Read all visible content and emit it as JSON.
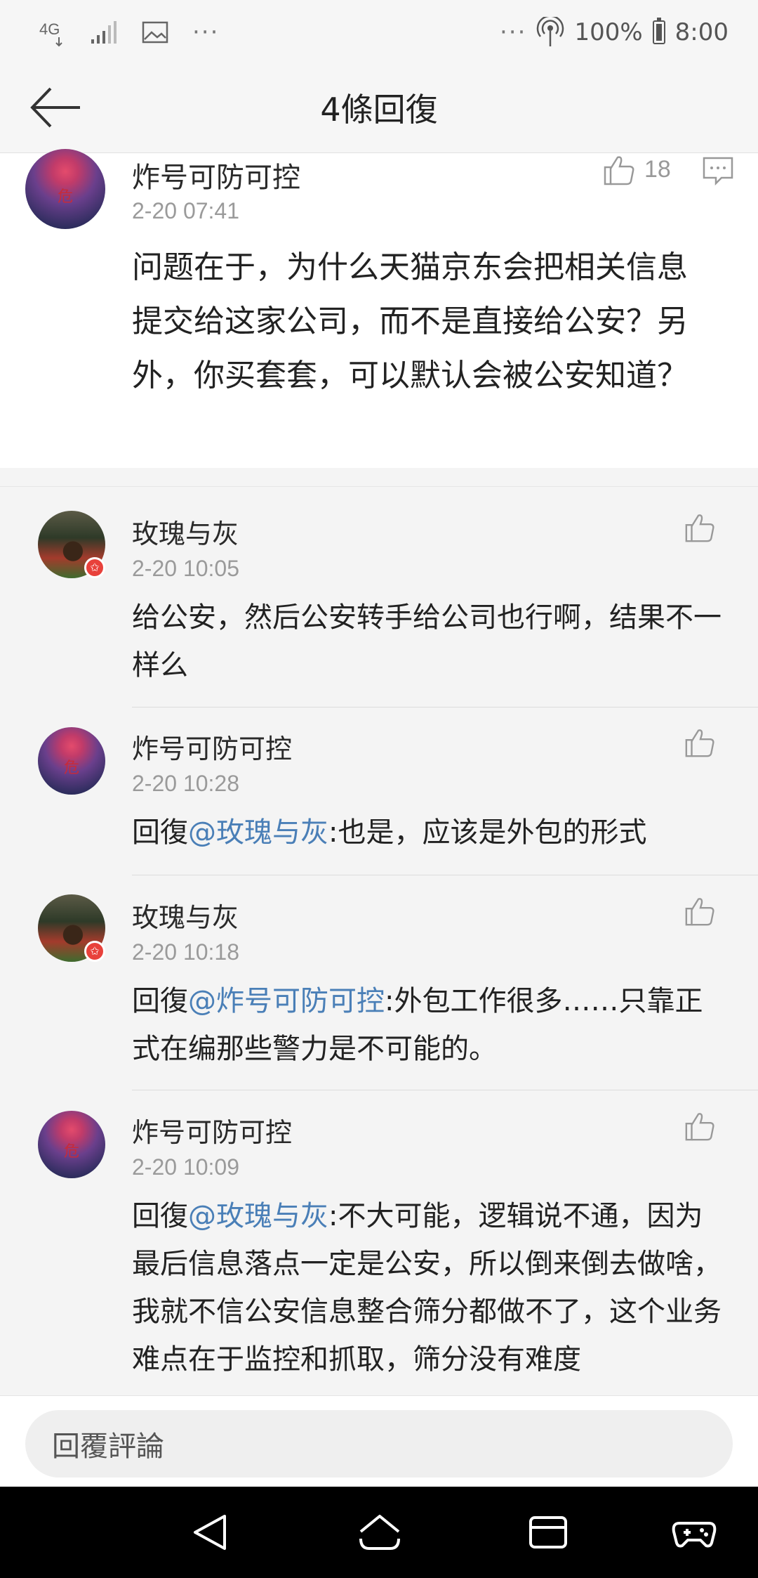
{
  "status_bar": {
    "network": "4G",
    "overflow": "···",
    "right_overflow": "···",
    "battery": "100%",
    "time": "8:00"
  },
  "header": {
    "back_icon": "back-arrow-icon",
    "title": "4條回復"
  },
  "main_comment": {
    "author": "炸号可防可控",
    "avatar_text": "危",
    "time": "2-20 07:41",
    "likes": "18",
    "text": "问题在于，为什么天猫京东会把相关信息提交给这家公司，而不是直接给公安？另外，你买套套，可以默认会被公安知道？"
  },
  "replies": [
    {
      "author": "玫瑰与灰",
      "time": "2-20 10:05",
      "prefix": "",
      "mention": "",
      "text": "给公安，然后公安转手给公司也行啊，结果不一样么"
    },
    {
      "author": "炸号可防可控",
      "avatar_text": "危",
      "time": "2-20 10:28",
      "prefix": "回復",
      "mention": "@玫瑰与灰",
      "text": ":也是，应该是外包的形式"
    },
    {
      "author": "玫瑰与灰",
      "time": "2-20 10:18",
      "prefix": "回復",
      "mention": "@炸号可防可控",
      "text": ":外包工作很多……只靠正式在编那些警力是不可能的。"
    },
    {
      "author": "炸号可防可控",
      "avatar_text": "危",
      "time": "2-20 10:09",
      "prefix": "回復",
      "mention": "@玫瑰与灰",
      "text": ":不大可能，逻辑说不通，因为最后信息落点一定是公安，所以倒来倒去做啥，我就不信公安信息整合筛分都做不了，这个业务难点在于监控和抓取，筛分没有难度"
    }
  ],
  "reply_box": {
    "placeholder": "回覆評論"
  },
  "colors": {
    "mention": "#4a7fb7",
    "badge": "#e8413b"
  }
}
